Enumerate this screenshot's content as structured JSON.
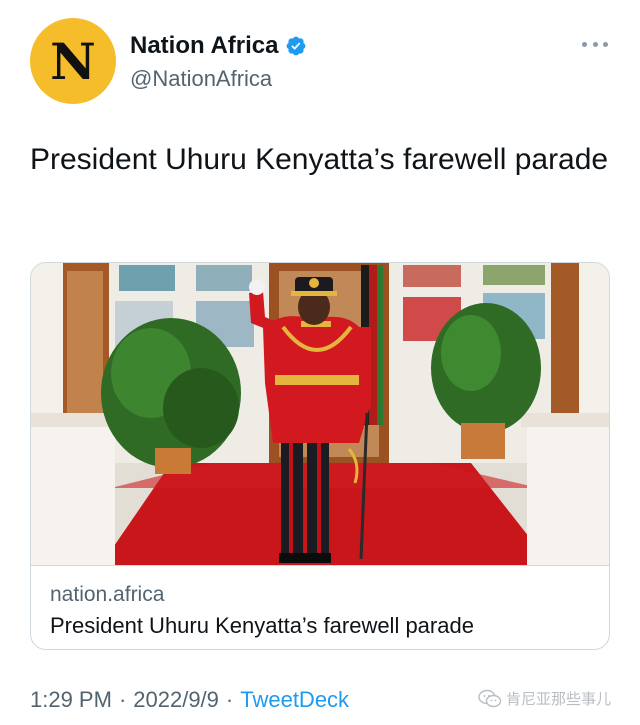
{
  "account": {
    "avatar_letter": "N",
    "display_name": "Nation Africa",
    "handle": "@NationAfrica",
    "verified": true
  },
  "tweet": {
    "text": "President Uhuru Kenyatta’s farewell parade"
  },
  "link_card": {
    "domain": "nation.africa",
    "title": "President Uhuru Kenyatta’s farewell parade"
  },
  "meta": {
    "time": "1:29 PM",
    "separator": "·",
    "date": "2022/9/9",
    "source": "TweetDeck"
  },
  "watermark": {
    "text": "肯尼亚那些事儿"
  },
  "colors": {
    "avatar_bg": "#f5bd2a",
    "verified_blue": "#1d9bf0",
    "link_blue": "#1d9bf0",
    "muted_text": "#536471",
    "carpet_red": "#c9161b",
    "uniform_red": "#d2191f"
  },
  "icons": [
    "verified-badge-icon",
    "more-options-icon",
    "wechat-icon"
  ]
}
